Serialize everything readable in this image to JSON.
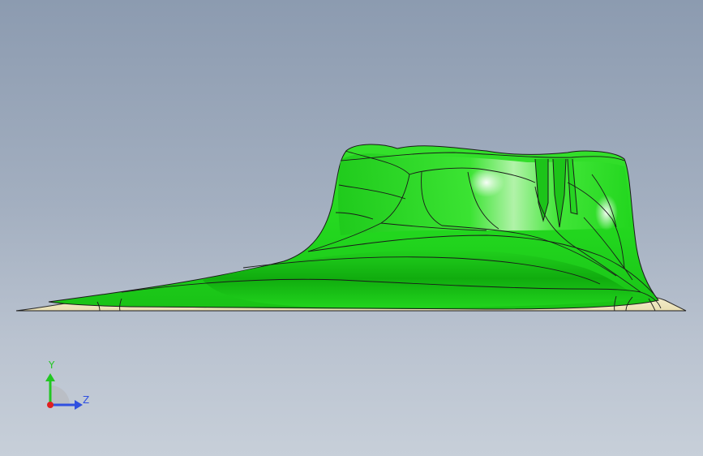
{
  "view": {
    "background_top": "#8c9bb0",
    "background_bottom": "#c7cfd9",
    "part_color": "#22d61e",
    "part_shadow_color": "#0ea80c",
    "base_color": "#f3eccb",
    "edge_color": "#1a1a1a"
  },
  "triad": {
    "y_label": "Y",
    "z_label": "Z",
    "y_color": "#22c722",
    "z_color": "#3050e0",
    "x_color": "#e02020",
    "icons": [
      "y-axis-arrow-icon",
      "z-axis-arrow-icon",
      "x-axis-origin-icon",
      "rotation-quadrant-icon"
    ]
  }
}
